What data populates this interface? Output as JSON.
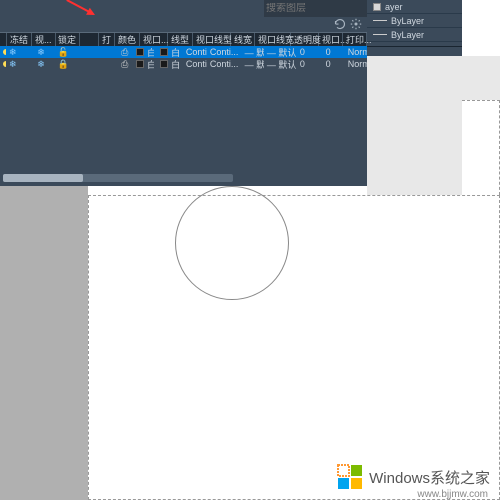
{
  "search": {
    "placeholder": "搜索图层"
  },
  "arrow": {
    "color": "#ff3030"
  },
  "header": {
    "cols": [
      "冻结",
      "视...",
      "锁定",
      "打",
      "颜色",
      "视口...",
      "线型",
      "视口线型",
      "线宽",
      "视口线宽",
      "透明度",
      "视口...",
      "打印..."
    ]
  },
  "layers": [
    {
      "on": true,
      "freeze": "❄",
      "vp": "❄",
      "lock": "🔓",
      "plot": "⎙",
      "color": "白",
      "vpcolor": "白",
      "ltype": "Continu...",
      "vpltype": "Conti...",
      "lw": "— 默认",
      "vplw": "— 默认",
      "trans": "0",
      "vptrans": "0",
      "pstyle": "Norma"
    },
    {
      "on": true,
      "freeze": "❄",
      "vp": "❄",
      "lock": "🔒",
      "plot": "⎙",
      "color": "白",
      "vpcolor": "白",
      "ltype": "Continu...",
      "vpltype": "Conti...",
      "lw": "— 默认",
      "vplw": "— 默认",
      "trans": "0",
      "vptrans": "0",
      "pstyle": "Norma"
    }
  ],
  "props": {
    "items": [
      {
        "label": "ayer"
      },
      {
        "label": "ByLayer"
      },
      {
        "label": "ByLayer"
      }
    ]
  },
  "watermark": {
    "text": "Windows系统之家",
    "url": "www.bjjmw.com"
  },
  "colors": {
    "panel": "#3b4a5a",
    "selected": "#0078d4"
  }
}
